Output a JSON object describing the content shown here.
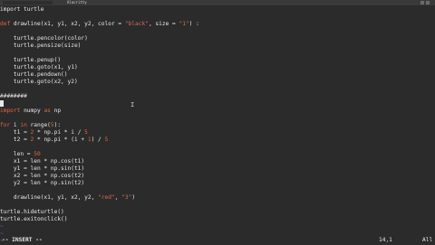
{
  "window": {
    "title": "Alacritty"
  },
  "editor": {
    "lines": [
      "import turtle",
      "",
      "def drawline(x1, y1, x2, y2, color = \"black\", size = \"1\") :",
      "",
      "    turtle.pencolor(color)",
      "    turtle.pensize(size)",
      "",
      "    turtle.penup()",
      "    turtle.goto(x1, y1)",
      "    turtle.pendown()",
      "    turtle.goto(x2, y2)",
      "",
      "########",
      "",
      "import numpy as np",
      "",
      "for i in range(5):",
      "    t1 = 2 * np.pi * i / 5",
      "    t2 = 2 * np.pi * (i + 1) / 5",
      "",
      "    len = 50",
      "    x1 = len * np.cos(t1)",
      "    y1 = len * np.sin(t1)",
      "    x2 = len * np.cos(t2)",
      "    y2 = len * np.sin(t2)",
      "",
      "    drawline(x1, y1, x2, y2, \"red\", \"3\")",
      "",
      "turtle.hideturtle()",
      "turtle.exitonclick()",
      "~",
      "~",
      "~"
    ]
  },
  "status": {
    "mode": "-- INSERT --",
    "position": "14,1",
    "scroll": "All"
  },
  "colors": {
    "background": "#2b2b2b",
    "keyword": "#e0673b",
    "string": "#d86a5a",
    "tilde": "#5a6fb0"
  }
}
